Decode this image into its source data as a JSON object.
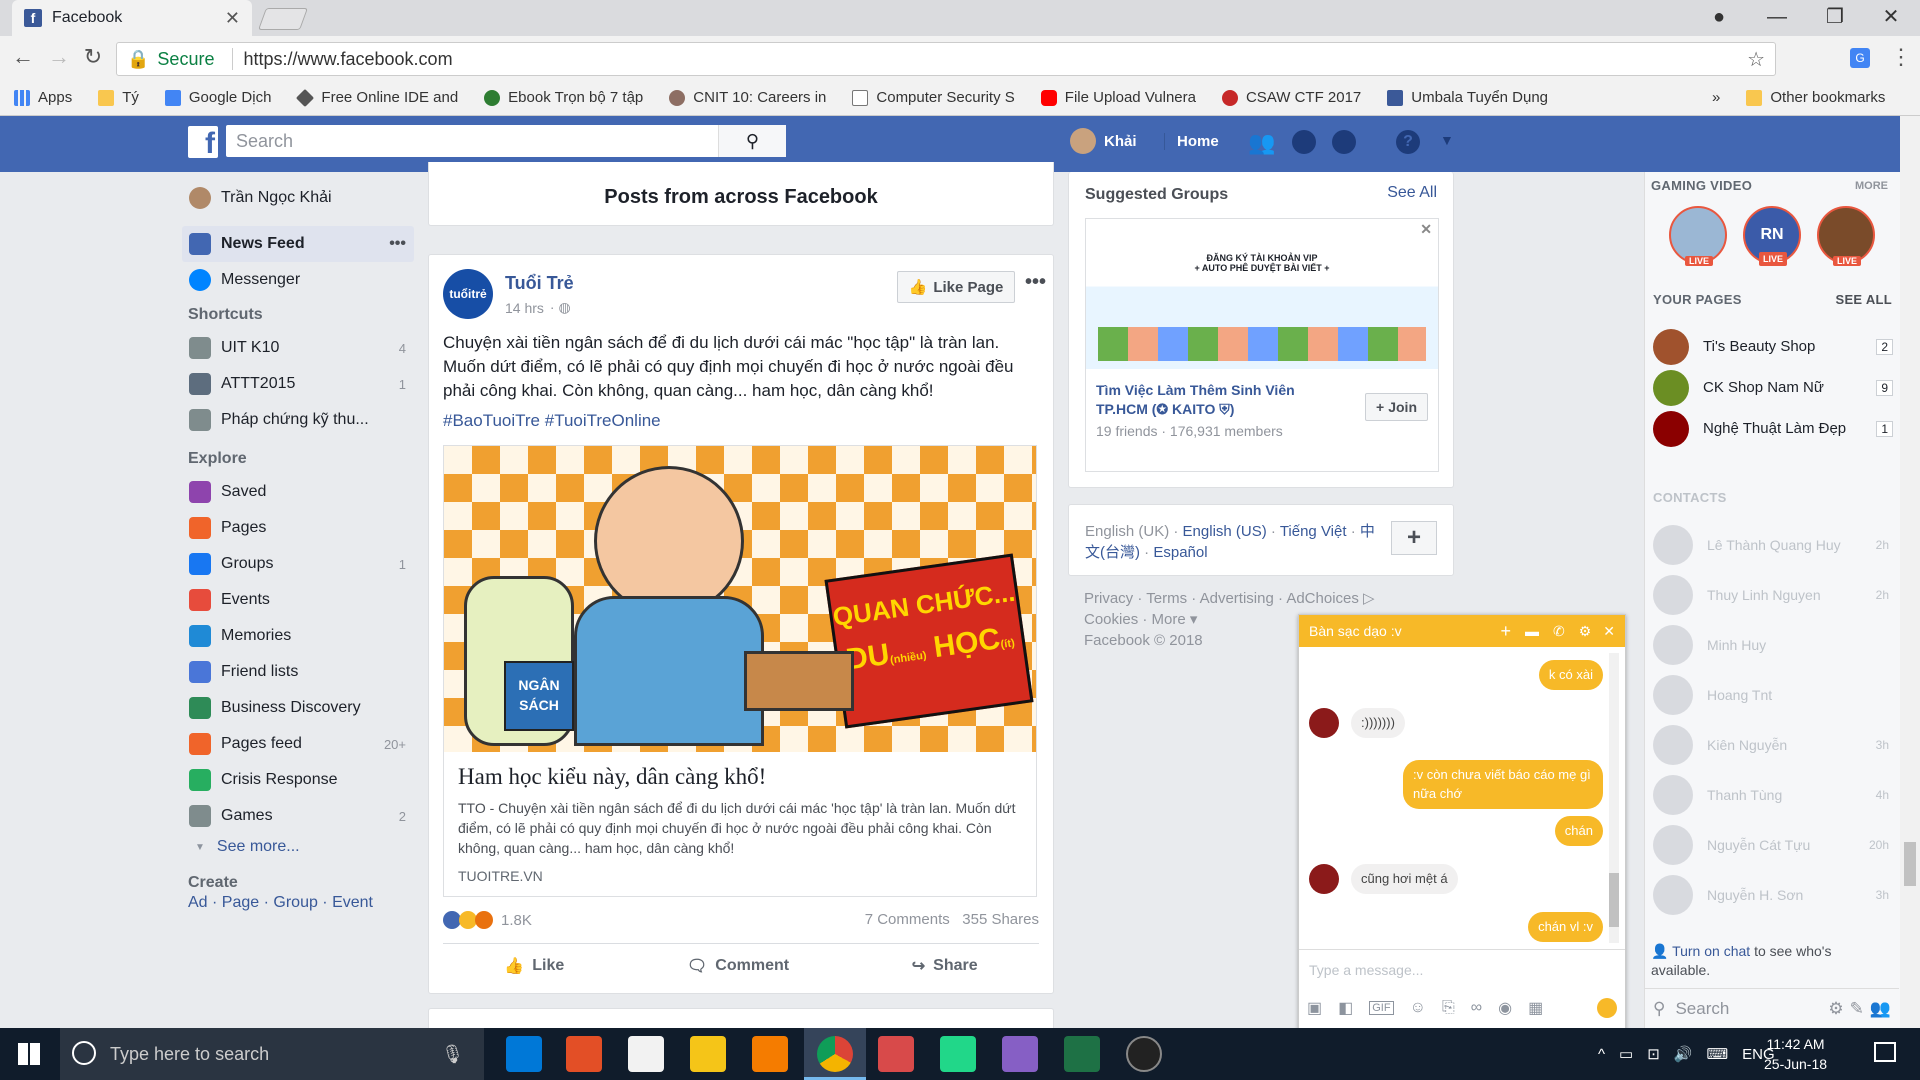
{
  "browser": {
    "tab_title": "Facebook",
    "secure_label": "Secure",
    "url": "https://www.facebook.com",
    "bookmarks": [
      {
        "label": "Apps",
        "color": "#4285f4"
      },
      {
        "label": "Tý",
        "color": "#f9c74f"
      },
      {
        "label": "Google Dịch",
        "color": "#4285f4"
      },
      {
        "label": "Free Online IDE and",
        "color": "#555555"
      },
      {
        "label": "Ebook Trọn bộ 7 tập",
        "color": "#2e7d32"
      },
      {
        "label": "CNIT 10: Careers in",
        "color": "#8d6e63"
      },
      {
        "label": "Computer Security S",
        "color": "#9e9e9e"
      },
      {
        "label": "File Upload Vulnera",
        "color": "#ff0000"
      },
      {
        "label": "CSAW CTF 2017",
        "color": "#c62828"
      },
      {
        "label": "Umbala Tuyển Dụng",
        "color": "#3b5998"
      }
    ],
    "more_bookmarks": "»",
    "other_bookmarks": "Other bookmarks"
  },
  "header": {
    "search_placeholder": "Search",
    "user_name": "Khải",
    "home_label": "Home"
  },
  "left_nav": {
    "profile_name": "Trần Ngọc Khải",
    "main": [
      {
        "label": "News Feed",
        "color": "#4267b2",
        "more": "•••"
      },
      {
        "label": "Messenger",
        "color": "#0084ff"
      }
    ],
    "shortcuts_title": "Shortcuts",
    "shortcuts": [
      {
        "label": "UIT K10",
        "count": "4",
        "color": "#7f8c8d"
      },
      {
        "label": "ATTT2015",
        "count": "1",
        "color": "#5d6d7e"
      },
      {
        "label": "Pháp chứng kỹ thu...",
        "count": "",
        "color": "#7f8c8d"
      }
    ],
    "explore_title": "Explore",
    "explore": [
      {
        "label": "Saved",
        "count": "",
        "color": "#8e44ad"
      },
      {
        "label": "Pages",
        "count": "",
        "color": "#f0642a"
      },
      {
        "label": "Groups",
        "count": "1",
        "color": "#1877f2"
      },
      {
        "label": "Events",
        "count": "",
        "color": "#e74c3c"
      },
      {
        "label": "Memories",
        "count": "",
        "color": "#1f8ad6"
      },
      {
        "label": "Friend lists",
        "count": "",
        "color": "#4a76d8"
      },
      {
        "label": "Business Discovery",
        "count": "",
        "color": "#2e8b57"
      },
      {
        "label": "Pages feed",
        "count": "20+",
        "color": "#f0642a"
      },
      {
        "label": "Crisis Response",
        "count": "",
        "color": "#27ae60"
      },
      {
        "label": "Games",
        "count": "2",
        "color": "#7f8c8d"
      }
    ],
    "see_more": "See more...",
    "create_title": "Create",
    "create_links": [
      "Ad",
      "Page",
      "Group",
      "Event"
    ]
  },
  "feed": {
    "section_title": "Posts from across Facebook",
    "post": {
      "page_name": "Tuổi Trẻ",
      "avatar_text": "tuổitrẻ",
      "time": "14 hrs",
      "like_page": "Like Page",
      "text": "Chuyện xài tiền ngân sách để đi du lịch dưới cái mác \"học tập\" là tràn lan. Muốn dứt điểm, có lẽ phải có quy định mọi chuyến đi học ở nước ngoài đều phải công khai. Còn không, quan càng... ham học, dân càng khổ!",
      "hashtags": "#BaoTuoiTre #TuoiTreOnline",
      "image_sign_1": "QUAN CHỨC...",
      "image_sign_2": "DU",
      "image_sign_small_1": "(nhiều)",
      "image_sign_3": "HỌC",
      "image_sign_small_2": "(ít)",
      "image_bag": "NGÂN SÁCH",
      "link_title": "Ham học kiểu này, dân càng khổ!",
      "link_desc": "TTO - Chuyện xài tiền ngân sách để đi du lịch dưới cái mác 'học tập' là tràn lan. Muốn dứt điểm, có lẽ phải có quy định mọi chuyến đi học ở nước ngoài đều phải công khai. Còn không, quan càng... ham học, dân càng khổ!",
      "link_domain": "TUOITRE.VN",
      "reactions": "1.8K",
      "comments": "7 Comments",
      "shares": "355 Shares",
      "actions": [
        "Like",
        "Comment",
        "Share"
      ]
    }
  },
  "right_col": {
    "suggested_title": "Suggested Groups",
    "see_all": "See All",
    "group_image_line1": "ĐĂNG KÝ TÀI KHOẢN VIP",
    "group_image_line2": "+ AUTO PHÊ DUYỆT BÀI VIẾT +",
    "group_name": "Tìm Việc Làm Thêm Sinh Viên TP.HCM (✪ KAITO ⛨)",
    "group_meta": "19 friends · 176,931 members",
    "join": "Join",
    "languages": [
      "English (UK)",
      "English (US)",
      "Tiếng Việt",
      "中文(台灣)",
      "Español"
    ],
    "footer_links": [
      "Privacy",
      "Terms",
      "Advertising",
      "AdChoices",
      "Cookies",
      "More"
    ],
    "copyright": "Facebook © 2018"
  },
  "sidebar": {
    "gaming_title": "GAMING VIDEO",
    "gaming_more": "MORE",
    "live_label": "LIVE",
    "gaming_avatars": [
      "",
      "RN",
      ""
    ],
    "pages_title": "YOUR PAGES",
    "pages_see_all": "SEE ALL",
    "pages": [
      {
        "name": "Ti's Beauty Shop",
        "count": "2"
      },
      {
        "name": "CK Shop Nam Nữ",
        "count": "9"
      },
      {
        "name": "Nghệ Thuật Làm Đẹp",
        "count": "1"
      }
    ],
    "contacts_title": "CONTACTS",
    "contacts": [
      {
        "name": "Lê Thành Quang Huy",
        "time": "2h"
      },
      {
        "name": "Thuy Linh Nguyen",
        "time": "2h"
      },
      {
        "name": "Minh Huy",
        "time": ""
      },
      {
        "name": "Hoang Tnt",
        "time": ""
      },
      {
        "name": "Kiên Nguyễn",
        "time": "3h"
      },
      {
        "name": "Thanh Tùng",
        "time": "4h"
      },
      {
        "name": "Nguyễn Cát Tựu",
        "time": "20h"
      },
      {
        "name": "Nguyễn H. Sơn",
        "time": "3h"
      }
    ],
    "turn_on_chat": "Turn on chat",
    "turn_on_rest": "to see who's available.",
    "search_placeholder": "Search"
  },
  "chat": {
    "title": "Bàn sạc dạo :v",
    "messages": [
      {
        "from": "me",
        "text": "k có xài"
      },
      {
        "from": "them",
        "text": ":)))))))"
      },
      {
        "from": "me",
        "text": ":v còn chưa viết báo cáo mẹ gì nữa chớ"
      },
      {
        "from": "me",
        "text": "chán"
      },
      {
        "from": "them",
        "text": "cũng hơi mệt á"
      },
      {
        "from": "me",
        "text": "chán vl :v"
      }
    ],
    "input_placeholder": "Type a message..."
  },
  "taskbar": {
    "search_placeholder": "Type here to search",
    "lang": "ENG",
    "time": "11:42 AM",
    "date": "25-Jun-18"
  }
}
